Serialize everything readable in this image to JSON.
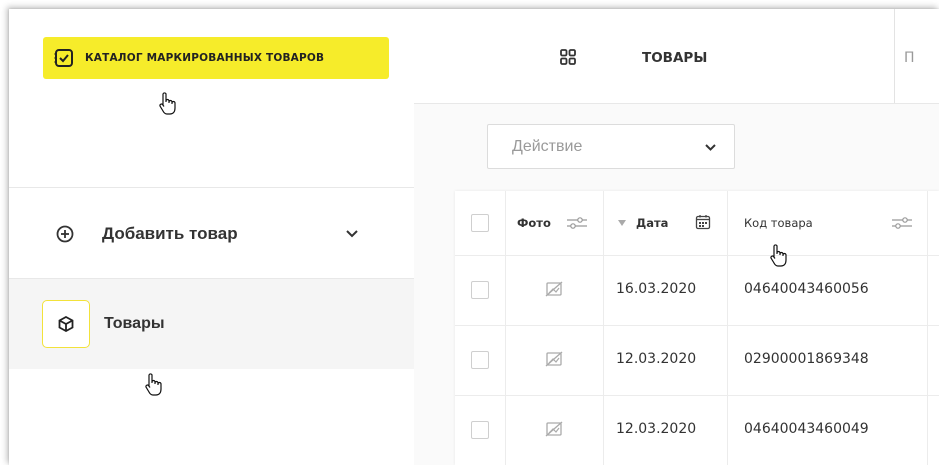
{
  "sidebar": {
    "catalog_button": {
      "label": "КАТАЛОГ МАРКИРОВАННЫХ ТОВАРОВ",
      "icon": "checkbox-icon",
      "color": "#f6ec2a"
    },
    "add_item": {
      "label": "Добавить товар",
      "icon": "plus-circle-icon",
      "chevron": "chevron-down-icon"
    },
    "items": {
      "label": "Товары",
      "icon": "box-icon"
    }
  },
  "header": {
    "grid_icon": "grid-icon",
    "tab_active": "ТОВАРЫ",
    "tab_next_partial": "П"
  },
  "action_select": {
    "value": "Действие"
  },
  "table": {
    "columns": [
      {
        "label": "Фото",
        "icon": "filter-sliders-icon"
      },
      {
        "label": "Дата",
        "icon": "calendar-icon",
        "sort": "sort-down-icon"
      },
      {
        "label": "Код товара",
        "icon": "filter-sliders-icon"
      }
    ],
    "rows": [
      {
        "date": "16.03.2020",
        "code": "04640043460056",
        "photo": "no-photo-icon"
      },
      {
        "date": "12.03.2020",
        "code": "02900001869348",
        "photo": "no-photo-icon"
      },
      {
        "date": "12.03.2020",
        "code": "04640043460049",
        "photo": "no-photo-icon"
      }
    ]
  }
}
